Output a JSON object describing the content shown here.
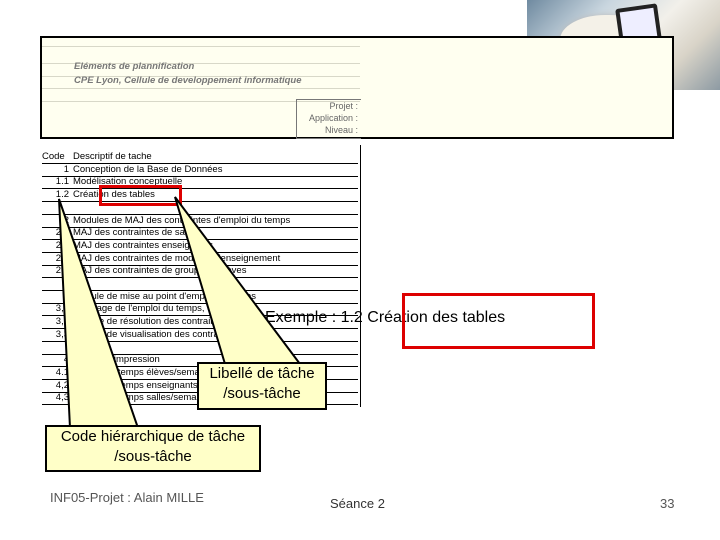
{
  "header": {
    "title": "Eléments de plannification",
    "subtitle": "CPE Lyon, Cellule de developpement informatique",
    "labels": [
      "Projet :",
      "Application :",
      "Niveau :"
    ]
  },
  "sheet": {
    "rows": [
      {
        "code": "Code",
        "label": "Descriptif de tache"
      },
      {
        "code": "1",
        "label": "Conception de la Base de Données"
      },
      {
        "code": "1.1",
        "label": "Modélisation conceptuelle"
      },
      {
        "code": "1.2",
        "label": "Création des tables"
      },
      {
        "code": "",
        "label": ""
      },
      {
        "code": "2",
        "label": "Modules de MAJ des contraintes d'emploi du temps"
      },
      {
        "code": "2,1",
        "label": "MAJ des contraintes de salles"
      },
      {
        "code": "2,2",
        "label": "MAJ des contraintes enseignants"
      },
      {
        "code": "2,3",
        "label": "MAJ des contraintes de modules d'enseignement"
      },
      {
        "code": "2,4",
        "label": "MAJ des contraintes de groupes d'élèves"
      },
      {
        "code": "",
        "label": ""
      },
      {
        "code": "3",
        "label": "Module de mise au point d'emploi du temps"
      },
      {
        "code": "3,1",
        "label": "Affichage de l'emploi du temps, contraintes"
      },
      {
        "code": "3,2",
        "label": "Module de résolution des contraintes"
      },
      {
        "code": "3,3",
        "label": "Module de visualisation des contraintes int"
      },
      {
        "code": "",
        "label": ""
      },
      {
        "code": "4",
        "label": "Module d'impression"
      },
      {
        "code": "4.1",
        "label": "Emploi du temps élèves/semaine"
      },
      {
        "code": "4,2",
        "label": "Emploi du temps enseignants"
      },
      {
        "code": "4,3",
        "label": "Emploi du temps salles/semaine"
      }
    ]
  },
  "example": "Exemple : 1.2 Création des tables",
  "callout_label": {
    "line1": "Libellé de tâche",
    "line2": "/sous-tâche"
  },
  "callout_code": {
    "line1": "Code hiérarchique de tâche",
    "line2": "/sous-tâche"
  },
  "footer": {
    "author": "INF05-Projet : Alain MILLE",
    "session": "Séance 2",
    "page": "33"
  },
  "colors": {
    "highlight": "#dd0000",
    "callout": "#ffffc8"
  }
}
